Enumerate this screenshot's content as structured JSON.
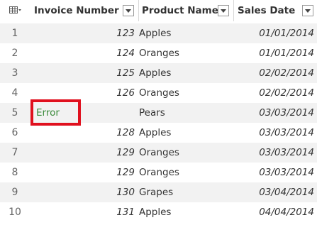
{
  "header": {
    "columns": [
      {
        "label": "Invoice Number"
      },
      {
        "label": "Product Name"
      },
      {
        "label": "Sales Date"
      }
    ]
  },
  "rows": [
    {
      "num": "1",
      "invoice": "123",
      "product": "Apples",
      "date": "01/01/2014"
    },
    {
      "num": "2",
      "invoice": "124",
      "product": "Oranges",
      "date": "01/01/2014"
    },
    {
      "num": "3",
      "invoice": "125",
      "product": "Apples",
      "date": "02/02/2014"
    },
    {
      "num": "4",
      "invoice": "126",
      "product": "Oranges",
      "date": "02/02/2014"
    },
    {
      "num": "5",
      "invoice": "Error",
      "product": "Pears",
      "date": "03/03/2014"
    },
    {
      "num": "6",
      "invoice": "128",
      "product": "Apples",
      "date": "03/03/2014"
    },
    {
      "num": "7",
      "invoice": "129",
      "product": "Oranges",
      "date": "03/03/2014"
    },
    {
      "num": "8",
      "invoice": "129",
      "product": "Oranges",
      "date": "03/03/2014"
    },
    {
      "num": "9",
      "invoice": "130",
      "product": "Grapes",
      "date": "03/04/2014"
    },
    {
      "num": "10",
      "invoice": "131",
      "product": "Apples",
      "date": "04/04/2014"
    }
  ],
  "icons": {
    "table": "table-icon",
    "filter": "chevron-down-icon"
  },
  "colors": {
    "error_text": "#3a8a3a",
    "error_highlight": "#e0101e",
    "alt_row": "#f2f2f2"
  }
}
